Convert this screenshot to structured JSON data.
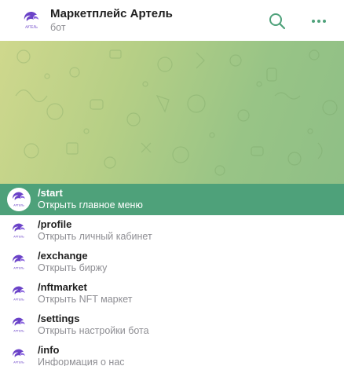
{
  "header": {
    "title": "Маркетплейс Артель",
    "subtitle": "бот",
    "icons": {
      "search": "search-icon",
      "more": "more-dots-icon",
      "avatar": "artel-logo"
    },
    "logo_text": "АРТЕЛЬ"
  },
  "colors": {
    "accent": "#4ea17a",
    "logo": "#6b43c8",
    "icon": "#4ea17a"
  },
  "commands": [
    {
      "name": "/start",
      "description": "Открыть главное меню",
      "active": true
    },
    {
      "name": "/profile",
      "description": "Открыть личный кабинет",
      "active": false
    },
    {
      "name": "/exchange",
      "description": "Открыть биржу",
      "active": false
    },
    {
      "name": "/nftmarket",
      "description": "Открыть NFT маркет",
      "active": false
    },
    {
      "name": "/settings",
      "description": "Открыть настройки бота",
      "active": false
    },
    {
      "name": "/info",
      "description": "Информация о нас",
      "active": false
    }
  ]
}
